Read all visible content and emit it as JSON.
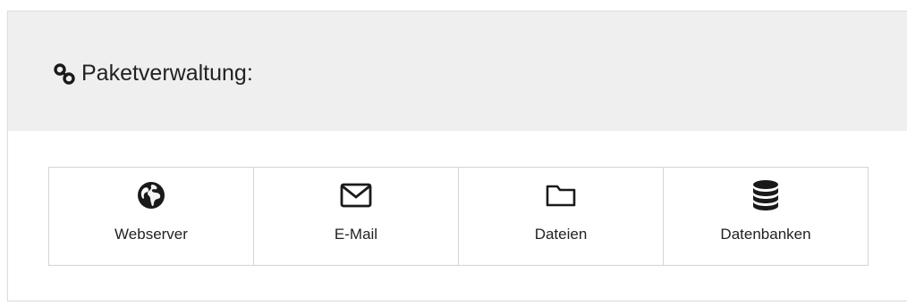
{
  "header": {
    "title": "Paketverwaltung:",
    "icon": "link-icon"
  },
  "packages": [
    {
      "label": "Webserver",
      "icon": "globe-icon"
    },
    {
      "label": "E-Mail",
      "icon": "envelope-icon"
    },
    {
      "label": "Dateien",
      "icon": "folder-icon"
    },
    {
      "label": "Datenbanken",
      "icon": "database-icon"
    }
  ],
  "colors": {
    "header_bg": "#efefef",
    "border": "#d4d4d4",
    "text": "#222222"
  }
}
